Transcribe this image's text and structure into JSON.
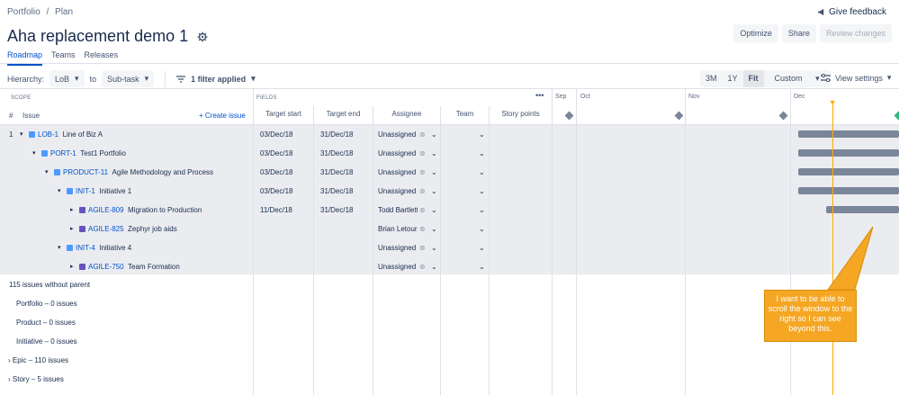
{
  "breadcrumb": [
    "Portfolio",
    "/",
    "Plan"
  ],
  "feedback_label": "Give feedback",
  "page_title": "Aha replacement demo 1",
  "top_buttons": {
    "optimize": "Optimize",
    "share": "Share",
    "review": "Review changes"
  },
  "tabs": [
    "Roadmap",
    "Teams",
    "Releases"
  ],
  "toolbar": {
    "hierarchy_label": "Hierarchy:",
    "from": "LoB",
    "to_label": "to",
    "to": "Sub-task",
    "filter": "1 filter applied"
  },
  "zoom": [
    "3M",
    "1Y",
    "Fit",
    "Custom"
  ],
  "view_settings": "View settings",
  "headers": {
    "scope": "SCOPE",
    "fields": "FIELDS",
    "num": "#",
    "issue": "Issue",
    "create_issue": "+ Create issue",
    "target_start": "Target start",
    "target_end": "Target end",
    "assignee": "Assignee",
    "team": "Team",
    "story_points": "Story points",
    "more": "•••"
  },
  "months": [
    "Sep",
    "Oct",
    "Nov",
    "Dec"
  ],
  "rows": [
    {
      "num": "1",
      "key": "LOB-1",
      "name": "Line of Biz A",
      "start": "03/Dec/18",
      "end": "31/Dec/18",
      "assignee": "Unassigned"
    },
    {
      "num": "",
      "key": "PORT-1",
      "name": "Test1 Portfolio",
      "start": "03/Dec/18",
      "end": "31/Dec/18",
      "assignee": "Unassigned"
    },
    {
      "num": "",
      "key": "PRODUCT-11",
      "name": "Agile Methodology and Process",
      "start": "03/Dec/18",
      "end": "31/Dec/18",
      "assignee": "Unassigned"
    },
    {
      "num": "",
      "key": "INIT-1",
      "name": "Initiative 1",
      "start": "03/Dec/18",
      "end": "31/Dec/18",
      "assignee": "Unassigned"
    },
    {
      "num": "",
      "key": "AGILE-809",
      "name": "Migration to Production",
      "start": "11/Dec/18",
      "end": "31/Dec/18",
      "assignee": "Todd Bartlett"
    },
    {
      "num": "",
      "key": "AGILE-825",
      "name": "Zephyr job aids",
      "start": "",
      "end": "",
      "assignee": "Brian Letour..."
    },
    {
      "num": "",
      "key": "INIT-4",
      "name": "Initiative 4",
      "start": "",
      "end": "",
      "assignee": "Unassigned"
    },
    {
      "num": "",
      "key": "AGILE-750",
      "name": "Team Formation",
      "start": "",
      "end": "",
      "assignee": "Unassigned"
    }
  ],
  "groups": {
    "without_parent": "115 issues without parent",
    "portfolio": "Portfolio – 0 issues",
    "product": "Product – 0 issues",
    "initiative": "Initiative – 0 issues",
    "epic": "Epic – 110 issues",
    "story": "Story – 5 issues"
  },
  "callout": "I want to be able to scroll the window to the right so I can see beyond this.",
  "colors": {
    "accent": "#0052cc",
    "callout": "#f5a623",
    "today": "#ffab00",
    "bar": "#7a869a"
  }
}
